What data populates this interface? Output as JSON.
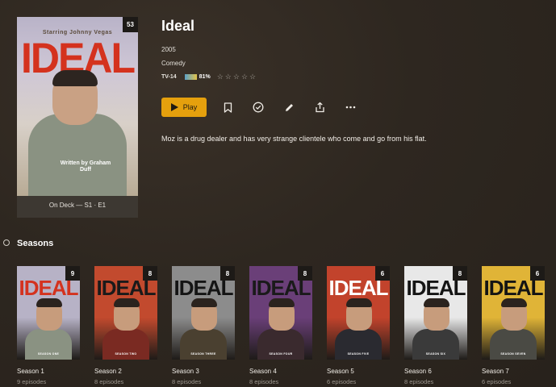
{
  "show": {
    "title": "Ideal",
    "year": "2005",
    "genre": "Comedy",
    "content_rating": "TV-14",
    "tomato_score": "81%",
    "tomato_badge": "TOMATO",
    "user_rating_stars": 0,
    "summary": "Moz is a drug dealer and has very strange clientele who come and go from his flat.",
    "unwatched_count": "53",
    "on_deck": "On Deck — S1 · E1",
    "poster": {
      "starring": "Starring Johnny Vegas",
      "logo": "IDEAL",
      "written_by": "Written by Graham Duff"
    }
  },
  "actions": {
    "play_label": "Play",
    "icons": [
      "bookmark-icon",
      "check-circle-icon",
      "pencil-icon",
      "share-icon",
      "more-icon"
    ]
  },
  "seasons_heading": "Seasons",
  "seasons": [
    {
      "label": "Season 1",
      "episodes": "9 episodes",
      "count": "9",
      "logo": "IDEAL",
      "subtitle": "SEASON ONE",
      "bg": "#b7b2c6",
      "logo_color": "#d4321e",
      "torso": "#8a9282"
    },
    {
      "label": "Season 2",
      "episodes": "8 episodes",
      "count": "8",
      "logo": "IDEAL",
      "subtitle": "SEASON TWO",
      "bg": "#c24a2e",
      "logo_color": "#1a1a1a",
      "torso": "#7a2a22"
    },
    {
      "label": "Season 3",
      "episodes": "8 episodes",
      "count": "8",
      "logo": "IDEAL",
      "subtitle": "SEASON THREE",
      "bg": "#8c8c8c",
      "logo_color": "#141414",
      "torso": "#4a4030"
    },
    {
      "label": "Season 4",
      "episodes": "8 episodes",
      "count": "8",
      "logo": "IDEAL",
      "subtitle": "SEASON FOUR",
      "bg": "#6a3f78",
      "logo_color": "#1a1a1a",
      "torso": "#3a2a2e"
    },
    {
      "label": "Season 5",
      "episodes": "6 episodes",
      "count": "6",
      "logo": "IDEAL",
      "subtitle": "SEASON FIVE",
      "bg": "#c2432c",
      "logo_color": "#ffffff",
      "torso": "#2a2a30"
    },
    {
      "label": "Season 6",
      "episodes": "8 episodes",
      "count": "8",
      "logo": "IDEAL",
      "subtitle": "SEASON SIX",
      "bg": "#e8e8e8",
      "logo_color": "#141414",
      "torso": "#3a3a3a"
    },
    {
      "label": "Season 7",
      "episodes": "6 episodes",
      "count": "6",
      "logo": "IDEAL",
      "subtitle": "SEASON SEVEN",
      "bg": "#e0b437",
      "logo_color": "#141414",
      "torso": "#4a4a44"
    }
  ],
  "colors": {
    "accent": "#e5a00d",
    "background": "#2e2720"
  }
}
